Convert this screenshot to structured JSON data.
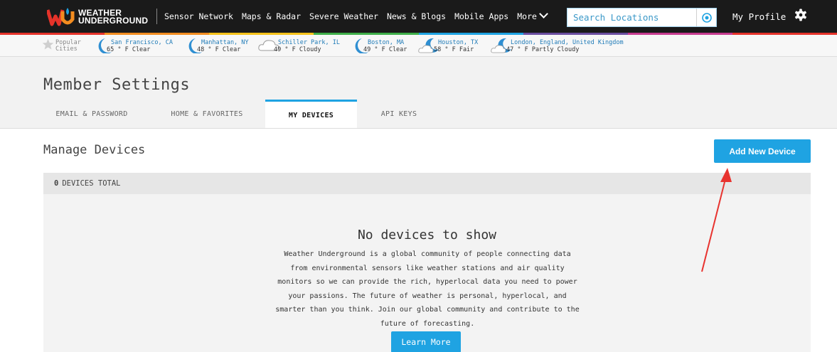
{
  "brand": {
    "line1": "WEATHER",
    "line2": "UNDERGROUND"
  },
  "nav": {
    "items": [
      "Sensor Network",
      "Maps & Radar",
      "Severe Weather",
      "News & Blogs",
      "Mobile Apps",
      "More"
    ],
    "search_placeholder": "Search Locations",
    "profile": "My Profile"
  },
  "popular": {
    "label_line1": "Popular",
    "label_line2": "Cities",
    "cities": [
      {
        "name": "San Francisco, CA",
        "conditions": "65 ° F Clear",
        "icon": "moon-icon"
      },
      {
        "name": "Manhattan, NY",
        "conditions": "48 ° F Clear",
        "icon": "moon-icon"
      },
      {
        "name": "Schiller Park, IL",
        "conditions": "49 ° F Cloudy",
        "icon": "cloud-icon"
      },
      {
        "name": "Boston, MA",
        "conditions": "49 ° F Clear",
        "icon": "moon-icon"
      },
      {
        "name": "Houston, TX",
        "conditions": "58 ° F Fair",
        "icon": "moon-cloud-icon"
      },
      {
        "name": "London, England, United Kingdom",
        "conditions": "47 ° F Partly Cloudy",
        "icon": "moon-cloud-icon"
      }
    ]
  },
  "page": {
    "title": "Member Settings",
    "tabs": [
      "EMAIL & PASSWORD",
      "HOME & FAVORITES",
      "MY DEVICES",
      "API KEYS"
    ],
    "active_tab": "MY DEVICES"
  },
  "devices": {
    "section_title": "Manage Devices",
    "add_button": "Add New Device",
    "count": "0",
    "count_label": "DEVICES TOTAL",
    "empty_title": "No devices to show",
    "empty_lines": [
      "Weather Underground is a global community of people connecting data",
      "from environmental sensors like weather stations and air quality",
      "monitors so we can provide the rich, hyperlocal data you need to power",
      "your passions. The future of weather is personal, hyperlocal, and",
      "smarter than you think. Join our global community and contribute to the",
      "future of forecasting."
    ],
    "learn_more": "Learn More"
  },
  "colors": {
    "accent": "#1fa3e2",
    "nav_bg": "#1a1a1a",
    "link": "#1f7bb8",
    "annotation_arrow": "#e8332f",
    "stripe": [
      "#e5332a",
      "#f28c20",
      "#f5c21a",
      "#3fae49",
      "#1fa3e2",
      "#6b4ea0",
      "#c63b8f",
      "#e5332a"
    ]
  }
}
